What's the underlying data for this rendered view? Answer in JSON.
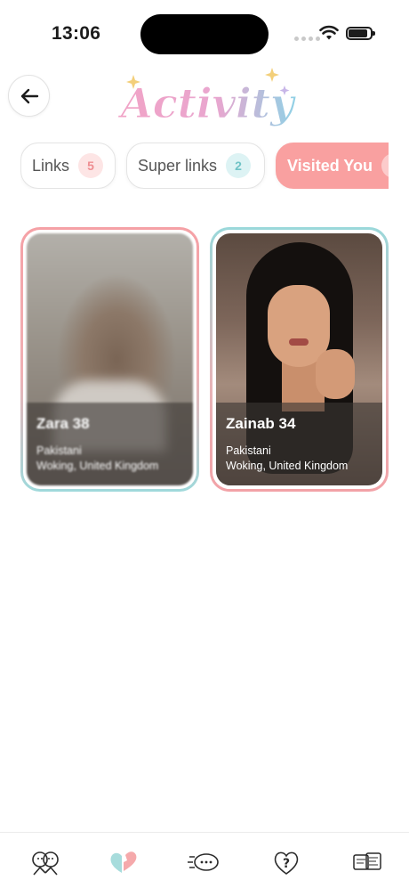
{
  "status_bar": {
    "time": "13:06"
  },
  "header": {
    "back_icon": "arrow-left-icon",
    "title": "Activity"
  },
  "tabs": [
    {
      "label": "Links",
      "count": "5",
      "active": false
    },
    {
      "label": "Super links",
      "count": "2",
      "active": false
    },
    {
      "label": "Visited You",
      "count": "",
      "active": true
    }
  ],
  "profiles": [
    {
      "name_age": "Zara 38",
      "ethnicity": "Pakistani",
      "location": "Woking, United Kingdom",
      "photo_blurred": true
    },
    {
      "name_age": "Zainab 34",
      "ethnicity": "Pakistani",
      "location": "Woking, United Kingdom",
      "photo_blurred": false
    }
  ],
  "bottom_nav": [
    {
      "icon": "discover-faces-icon",
      "active": false
    },
    {
      "icon": "activity-hearts-icon",
      "active": true
    },
    {
      "icon": "chat-bubbles-icon",
      "active": false
    },
    {
      "icon": "question-heart-icon",
      "active": false
    },
    {
      "icon": "video-tickets-icon",
      "active": false
    }
  ],
  "colors": {
    "pink": "#f9a0a0",
    "teal": "#9ad8da",
    "link_badge": "#ef8e92",
    "superlink_badge": "#6fc3c6"
  }
}
